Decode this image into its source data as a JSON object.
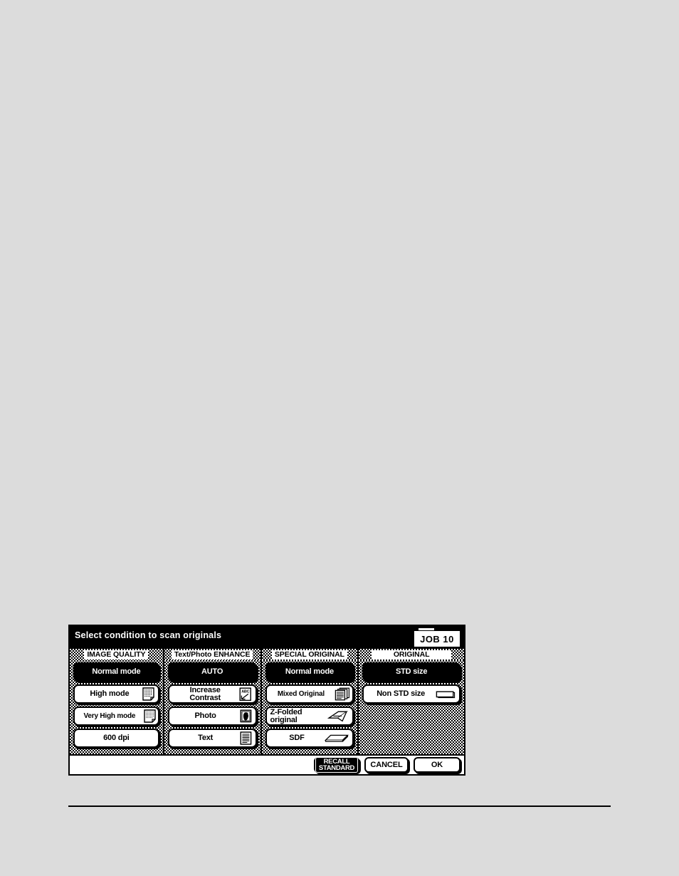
{
  "panel": {
    "title": "Select condition to scan originals",
    "job_indicator": "JOB 10",
    "columns": [
      {
        "header": "IMAGE QUALITY",
        "buttons": [
          {
            "label": "Normal mode",
            "selected": true,
            "icon": null
          },
          {
            "label": "High mode",
            "selected": false,
            "icon": "halftone-document-icon"
          },
          {
            "label": "Very High mode",
            "selected": false,
            "icon": "halftone-document-icon"
          },
          {
            "label": "600 dpi",
            "selected": false,
            "icon": null
          }
        ]
      },
      {
        "header": "Text/Photo ENHANCE",
        "buttons": [
          {
            "label": "AUTO",
            "selected": true,
            "icon": null
          },
          {
            "label_line1": "Increase",
            "label_line2": "Contrast",
            "selected": false,
            "icon": "abc-contrast-document-icon"
          },
          {
            "label": "Photo",
            "selected": false,
            "icon": "photo-portrait-icon"
          },
          {
            "label": "Text",
            "selected": false,
            "icon": "lined-text-document-icon"
          }
        ]
      },
      {
        "header": "SPECIAL ORIGINAL",
        "buttons": [
          {
            "label": "Normal mode",
            "selected": true,
            "icon": null
          },
          {
            "label": "Mixed Original",
            "selected": false,
            "icon": "stacked-documents-icon"
          },
          {
            "label_line1": "Z-Folded",
            "label_line2": "original",
            "selected": false,
            "icon": "z-folded-paper-icon"
          },
          {
            "label": "SDF",
            "selected": false,
            "icon": "single-sheet-icon"
          }
        ]
      },
      {
        "header": "ORIGINAL",
        "buttons": [
          {
            "label": "STD size",
            "selected": true,
            "icon": null
          },
          {
            "label": "Non STD size",
            "selected": false,
            "icon": "rectangle-outline-icon"
          }
        ]
      }
    ],
    "footer": {
      "recall_standard_line1": "RECALL",
      "recall_standard_line2": "STANDARD",
      "cancel_label": "CANCEL",
      "ok_label": "OK"
    }
  },
  "colors": {
    "page_background": "#dcdcdc",
    "panel_background": "#ffffff",
    "ink": "#000000",
    "selected_text": "#ffffff"
  }
}
